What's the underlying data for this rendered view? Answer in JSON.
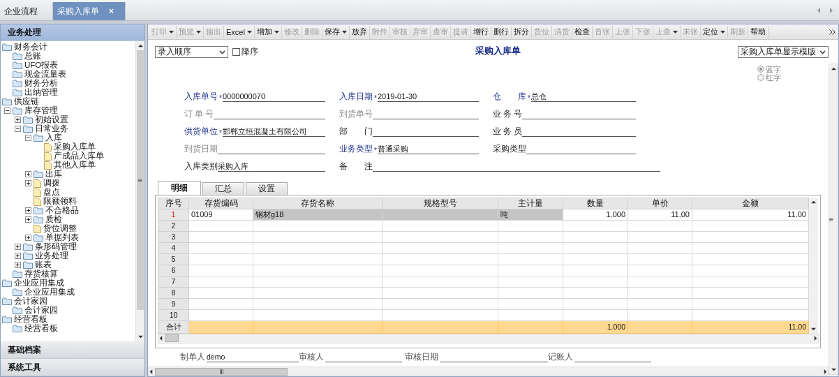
{
  "doc_tabs": [
    {
      "label": "企业流程",
      "selected": false,
      "closable": false
    },
    {
      "label": "采购入库单",
      "selected": true,
      "closable": true
    }
  ],
  "close_glyph": "×",
  "sidebar": {
    "panels": [
      {
        "label": "业务处理",
        "selected": true
      },
      {
        "label": "基础档案",
        "selected": false
      },
      {
        "label": "系统工具",
        "selected": false
      }
    ],
    "tree": [
      {
        "label": "财务会计",
        "kind": "folder",
        "children": [
          {
            "label": "总账",
            "kind": "folder"
          },
          {
            "label": "UFO报表",
            "kind": "folder"
          },
          {
            "label": "现金流量表",
            "kind": "folder"
          },
          {
            "label": "财务分析",
            "kind": "folder"
          },
          {
            "label": "出纳管理",
            "kind": "folder"
          }
        ]
      },
      {
        "label": "供应链",
        "kind": "folder",
        "children": [
          {
            "label": "库存管理",
            "kind": "folder",
            "expanded": true,
            "children": [
              {
                "label": "初始设置",
                "kind": "folder",
                "expanded": false
              },
              {
                "label": "日常业务",
                "kind": "folder",
                "expanded": true,
                "children": [
                  {
                    "label": "入库",
                    "kind": "folder",
                    "expanded": true,
                    "children": [
                      {
                        "label": "采购入库单",
                        "kind": "doc"
                      },
                      {
                        "label": "产成品入库单",
                        "kind": "doc"
                      },
                      {
                        "label": "其他入库单",
                        "kind": "doc"
                      }
                    ]
                  },
                  {
                    "label": "出库",
                    "kind": "folder",
                    "expanded": false
                  },
                  {
                    "label": "调拨",
                    "kind": "doc",
                    "expanded": false
                  },
                  {
                    "label": "盘点",
                    "kind": "doc"
                  },
                  {
                    "label": "限额领料",
                    "kind": "doc"
                  },
                  {
                    "label": "不合格品",
                    "kind": "folder",
                    "expanded": false
                  },
                  {
                    "label": "质检",
                    "kind": "folder",
                    "expanded": false
                  },
                  {
                    "label": "货位调整",
                    "kind": "doc"
                  },
                  {
                    "label": "单据列表",
                    "kind": "folder",
                    "expanded": false
                  }
                ]
              },
              {
                "label": "条形码管理",
                "kind": "folder",
                "expanded": false
              },
              {
                "label": "业务处理",
                "kind": "folder",
                "expanded": false
              },
              {
                "label": "账表",
                "kind": "folder",
                "expanded": false
              }
            ]
          },
          {
            "label": "存货核算",
            "kind": "folder"
          }
        ]
      },
      {
        "label": "企业应用集成",
        "kind": "folder",
        "children": [
          {
            "label": "企业应用集成",
            "kind": "folder"
          }
        ]
      },
      {
        "label": "会计家园",
        "kind": "folder",
        "children": [
          {
            "label": "会计家园",
            "kind": "folder"
          }
        ]
      },
      {
        "label": "经营看板",
        "kind": "folder",
        "children": [
          {
            "label": "经营看板",
            "kind": "folder"
          }
        ]
      }
    ]
  },
  "toolbar": [
    {
      "label": "打印",
      "dropdown": true,
      "disabled": true
    },
    {
      "label": "预览",
      "dropdown": true,
      "disabled": true
    },
    {
      "label": "输出",
      "dropdown": false,
      "disabled": true
    },
    {
      "label": "Excel",
      "dropdown": true,
      "disabled": false
    },
    {
      "label": "增加",
      "dropdown": true,
      "disabled": false
    },
    {
      "label": "修改",
      "dropdown": false,
      "disabled": true
    },
    {
      "label": "删除",
      "dropdown": false,
      "disabled": true
    },
    {
      "label": "保存",
      "dropdown": true,
      "disabled": false
    },
    {
      "label": "放弃",
      "dropdown": false,
      "disabled": false
    },
    {
      "label": "附件",
      "dropdown": false,
      "disabled": true
    },
    {
      "label": "审核",
      "dropdown": false,
      "disabled": true
    },
    {
      "label": "弃审",
      "dropdown": false,
      "disabled": true
    },
    {
      "label": "查审",
      "dropdown": false,
      "disabled": true
    },
    {
      "label": "提请",
      "dropdown": false,
      "disabled": true
    },
    {
      "label": "增行",
      "dropdown": false,
      "disabled": false
    },
    {
      "label": "删行",
      "dropdown": false,
      "disabled": false
    },
    {
      "label": "拆分",
      "dropdown": false,
      "disabled": false
    },
    {
      "label": "货位",
      "dropdown": false,
      "disabled": true
    },
    {
      "label": "清货",
      "dropdown": false,
      "disabled": true
    },
    {
      "label": "检查",
      "dropdown": false,
      "disabled": false
    },
    {
      "label": "首张",
      "dropdown": false,
      "disabled": true
    },
    {
      "label": "上张",
      "dropdown": false,
      "disabled": true
    },
    {
      "label": "下张",
      "dropdown": false,
      "disabled": true
    },
    {
      "label": "上查",
      "dropdown": true,
      "disabled": true
    },
    {
      "label": "末张",
      "dropdown": false,
      "disabled": true
    },
    {
      "label": "定位",
      "dropdown": true,
      "disabled": false
    },
    {
      "label": "刷新",
      "dropdown": false,
      "disabled": true
    },
    {
      "label": "帮助",
      "dropdown": false,
      "disabled": false
    }
  ],
  "sort_select": {
    "value": "录入顺序"
  },
  "descending": {
    "label": "降序",
    "checked": false
  },
  "title": "采购入库单",
  "template_select": {
    "value": "采购入库单显示模版"
  },
  "color_radios": [
    {
      "label": "蓝字",
      "selected": true,
      "disabled": true
    },
    {
      "label": "红字",
      "selected": false,
      "disabled": true
    }
  ],
  "header_fields": [
    {
      "label": "入库单号",
      "required": true,
      "kind": "key",
      "value": "0000000070"
    },
    {
      "label": "入库日期",
      "required": true,
      "kind": "key",
      "value": "2019-01-30"
    },
    {
      "label": "仓　　库",
      "required": true,
      "kind": "key",
      "value": "总仓"
    },
    {
      "label": "订 单 号",
      "required": false,
      "kind": "muted"
    },
    {
      "label": "到货单号",
      "required": false,
      "kind": "muted"
    },
    {
      "label": "业 务 号",
      "required": false,
      "kind": "normal"
    },
    {
      "label": "供货单位",
      "required": true,
      "kind": "key",
      "value": "邯郸立恒混凝土有限公司"
    },
    {
      "label": "部　　门",
      "required": false,
      "kind": "normal"
    },
    {
      "label": "业 务 员",
      "required": false,
      "kind": "normal"
    },
    {
      "label": "到货日期",
      "required": false,
      "kind": "muted"
    },
    {
      "label": "业务类型",
      "required": true,
      "kind": "key",
      "value": "普通采购"
    },
    {
      "label": "采购类型",
      "required": false,
      "kind": "normal"
    },
    {
      "label": "入库类别",
      "required": false,
      "kind": "normal",
      "value": "采购入库"
    },
    {
      "label": "备　　注",
      "required": false,
      "kind": "normal",
      "wide": true
    }
  ],
  "required_mark": "*",
  "detail_tabs": [
    {
      "label": "明细",
      "selected": true
    },
    {
      "label": "汇总",
      "selected": false
    },
    {
      "label": "设置",
      "selected": false
    }
  ],
  "table": {
    "corner": "序号",
    "columns": [
      {
        "label": "存货编码",
        "kind": "text",
        "locked": false
      },
      {
        "label": "存货名称",
        "kind": "text",
        "locked": true
      },
      {
        "label": "规格型号",
        "kind": "text",
        "locked": true
      },
      {
        "label": "主计量",
        "kind": "text",
        "locked": true
      },
      {
        "label": "数量",
        "kind": "number",
        "locked": false,
        "total": "1.000"
      },
      {
        "label": "单价",
        "kind": "number",
        "locked": false
      },
      {
        "label": "金额",
        "kind": "number",
        "locked": false,
        "total": "11.00"
      }
    ],
    "rows": [
      {
        "no": "1",
        "selected": true,
        "code": "01009",
        "name": "钢材g18",
        "unit": "吨",
        "quantity": "1.000",
        "price": "11.00",
        "amount": "11.00"
      },
      {
        "no": "2",
        "selected": false
      },
      {
        "no": "3",
        "selected": false
      },
      {
        "no": "4",
        "selected": false
      },
      {
        "no": "5",
        "selected": false
      },
      {
        "no": "6",
        "selected": false
      },
      {
        "no": "7",
        "selected": false
      },
      {
        "no": "8",
        "selected": false
      },
      {
        "no": "9",
        "selected": false
      },
      {
        "no": "10",
        "selected": false
      }
    ],
    "total_label": "合计"
  },
  "signatures": [
    {
      "label": "制单人",
      "value": "demo"
    },
    {
      "label": "审核人"
    },
    {
      "label": "审核日期"
    },
    {
      "label": "记账人"
    }
  ]
}
